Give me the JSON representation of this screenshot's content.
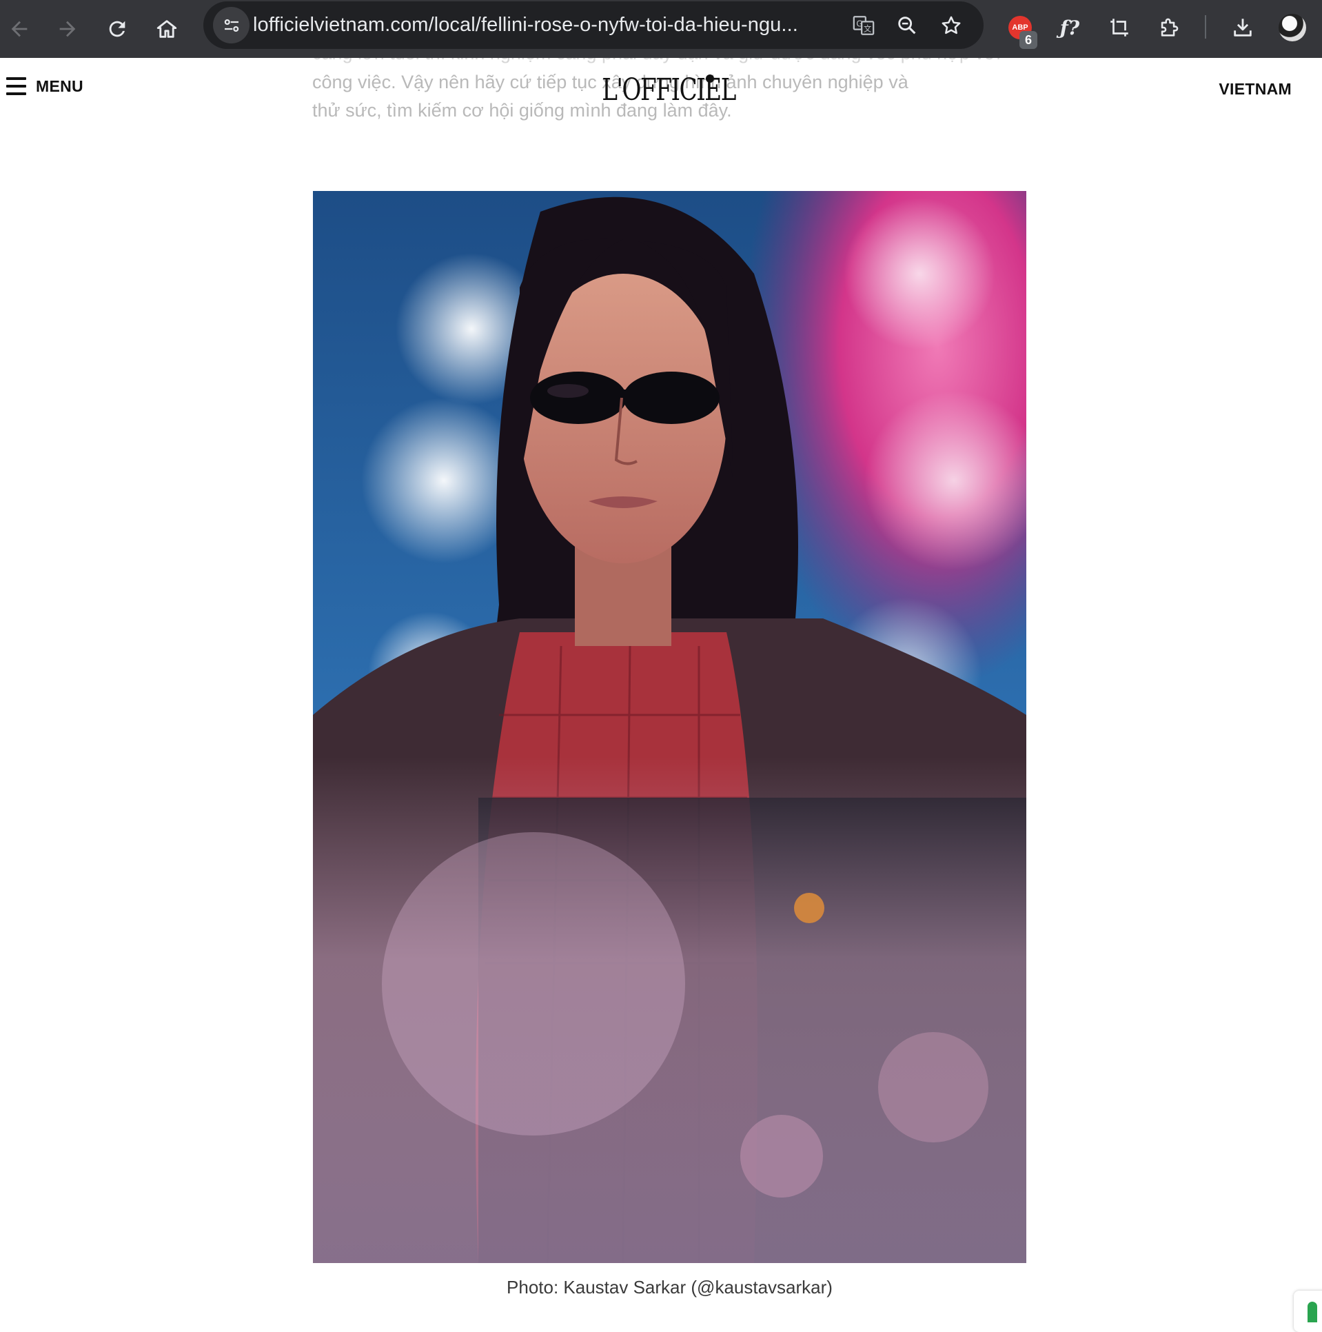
{
  "browser": {
    "url": "lofficielvietnam.com/local/fellini-rose-o-nyfw-toi-da-hieu-ngu...",
    "extension_badge_label": "ABP",
    "extension_badge_count": "6",
    "icons": [
      "back-arrow-icon",
      "forward-arrow-icon",
      "reload-icon",
      "home-icon",
      "site-info-icon",
      "translate-icon",
      "zoom-icon",
      "bookmark-star-icon",
      "adblock-icon",
      "font-identifier-icon",
      "screenshot-crop-icon",
      "extensions-puzzle-icon",
      "download-icon",
      "profile-avatar"
    ]
  },
  "header": {
    "menu_label": "MENU",
    "logo_text": "L'OFFICIEL",
    "region_label": "VIETNAM"
  },
  "article": {
    "faded_line_1": "càng lớn tuổi thì kinh nghiệm càng phải dày dặn và giữ được dáng vóc phù hợp với",
    "faded_line_2": "công việc. Vậy nên hãy cứ tiếp tục xây dựng hình ảnh chuyên nghiệp và",
    "faded_line_3": "thử sức, tìm kiếm cơ hội giống mình đang làm đây.",
    "photo_caption": "Photo: Kaustav Sarkar (@kaustavsarkar)"
  },
  "colors": {
    "chrome_bg": "#35363a",
    "omnibox_bg": "#202124",
    "text_light": "#e8eaed",
    "abp_red": "#e3352d",
    "feedback_green": "#2aa44f"
  }
}
